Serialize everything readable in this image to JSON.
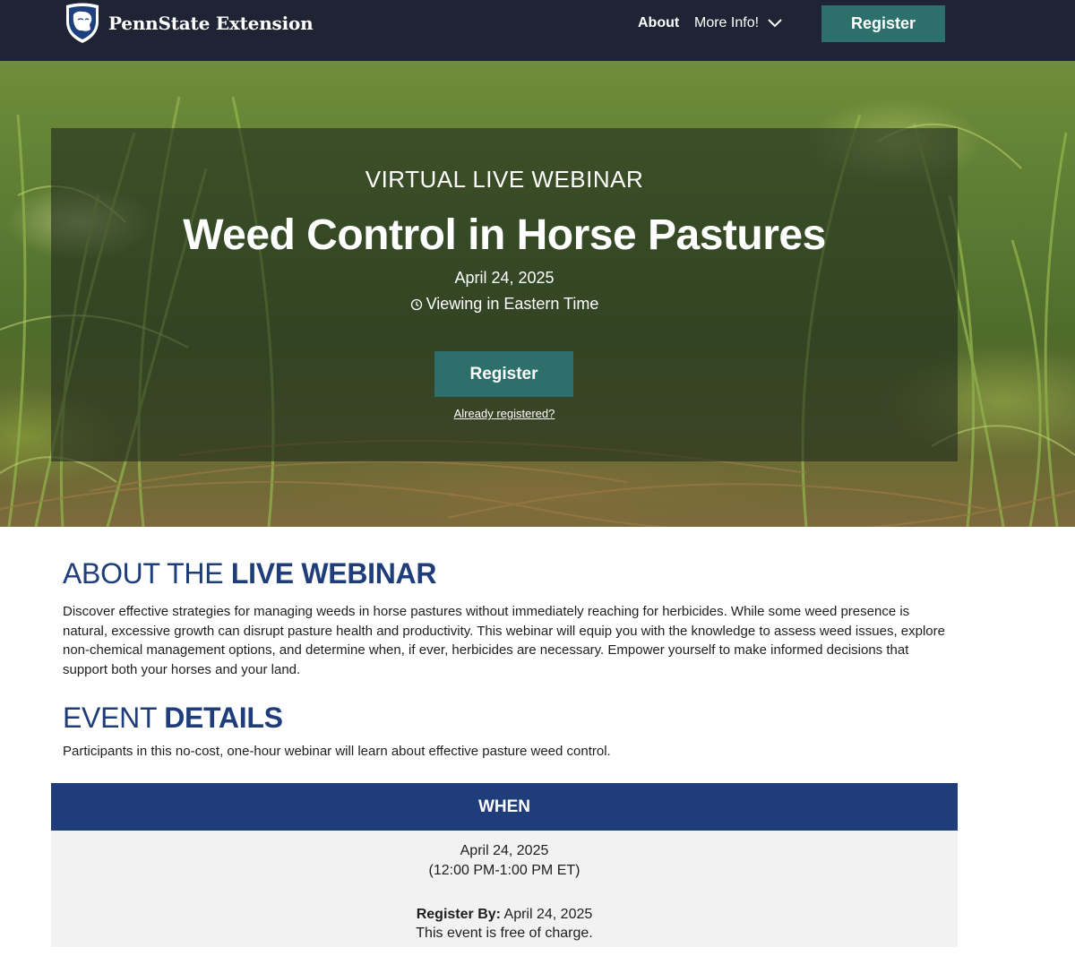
{
  "header": {
    "brand": "PennState Extension",
    "nav_about": "About",
    "nav_more": "More Info!",
    "register_label": "Register"
  },
  "hero": {
    "kicker": "VIRTUAL LIVE WEBINAR",
    "title": "Weed Control in Horse Pastures",
    "date": "April 24, 2025",
    "timezone": "Viewing in Eastern Time",
    "register_label": "Register",
    "already_registered": "Already registered?"
  },
  "about": {
    "heading_light": "ABOUT THE ",
    "heading_bold": "LIVE WEBINAR",
    "body": "Discover effective strategies for managing weeds in horse pastures without immediately reaching for herbicides. While some weed presence is natural, excessive growth can disrupt pasture health and productivity. This webinar will equip you with the knowledge to assess weed issues, explore non-chemical management options, and determine when, if ever, herbicides are necessary. Empower yourself to make informed decisions that support both your horses and your land."
  },
  "event": {
    "heading_light": "EVENT ",
    "heading_bold": "DETAILS",
    "body": "Participants in this no-cost, one-hour webinar will learn about effective pasture weed control."
  },
  "when": {
    "heading": "WHEN",
    "date": "April 24, 2025",
    "time": "(12:00 PM-1:00 PM ET)",
    "register_by_label": "Register By:",
    "register_by_date": " April 24, 2025",
    "cost": "This event is free of charge."
  },
  "colors": {
    "header_bg": "#1e2433",
    "button_teal": "#2d6f6b",
    "heading_blue": "#1f3d7a",
    "panel_gray": "#f2f2f2"
  },
  "icons": {
    "logo": "nittany-lion-shield-icon",
    "dropdown": "chevron-down-icon",
    "timezone": "clock-icon"
  }
}
